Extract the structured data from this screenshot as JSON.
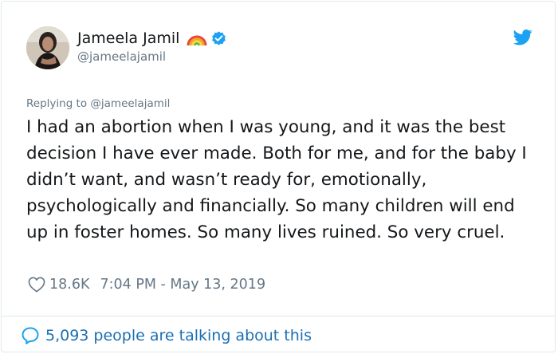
{
  "user": {
    "display_name": "Jameela Jamil",
    "handle": "@jameelajamil",
    "emoji_icon": "rainbow-icon",
    "verified_icon": "verified-badge-icon"
  },
  "tweet": {
    "replying_to": "Replying to @jameelajamil",
    "text": "I had an abortion when I was young, and it was the best decision I have ever made. Both for me, and for the baby I didn’t want, and wasn’t ready for, emotionally, psychologically and financially. So many children will end up in foster homes. So many lives ruined. So very cruel.",
    "likes": "18.6K",
    "timestamp": "7:04 PM - May 13, 2019"
  },
  "footer": {
    "talking": "5,093 people are talking about this"
  },
  "colors": {
    "twitter_blue": "#1da1f2",
    "muted_text": "#657786",
    "link_text": "#1b6fb3",
    "border": "#e1e8ed"
  }
}
